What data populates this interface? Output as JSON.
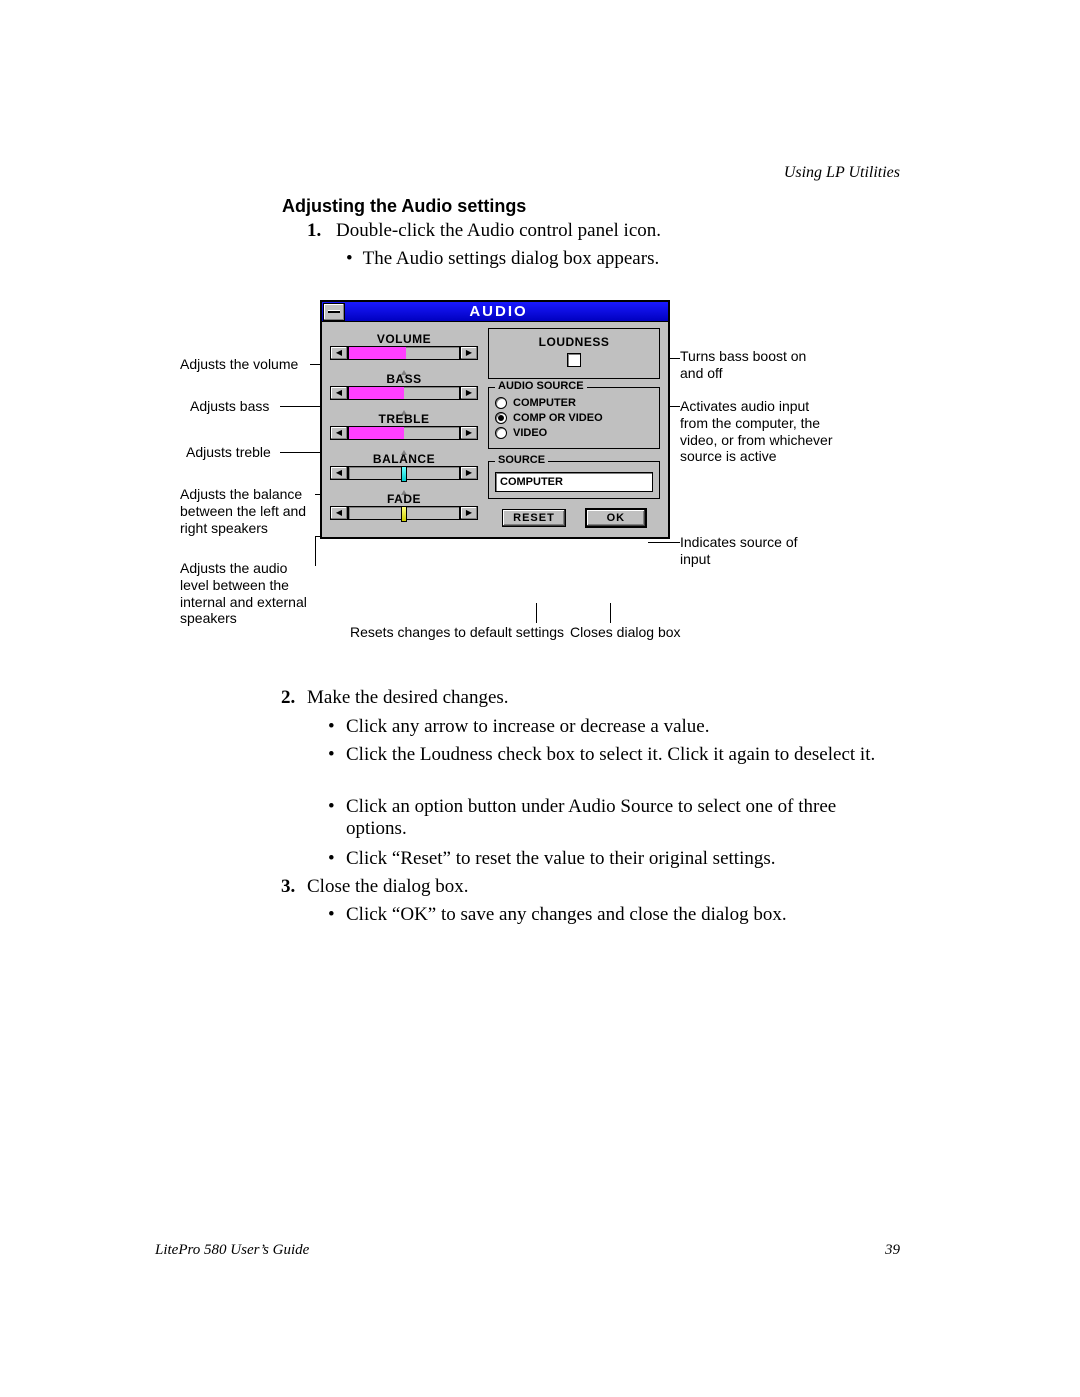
{
  "header": {
    "right": "Using LP Utilities"
  },
  "section_title": "Adjusting the Audio settings",
  "step1_num": "1.",
  "step1_text": "Double-click the Audio control panel icon.",
  "step1_sub": "The Audio settings dialog box appears.",
  "dialog": {
    "title": "AUDIO",
    "sliders": {
      "volume": {
        "label": "VOLUME",
        "fill_pct": 52
      },
      "bass": {
        "label": "BASS",
        "fill_pct": 50
      },
      "treble": {
        "label": "TREBLE",
        "fill_pct": 50
      },
      "balance": {
        "label": "BALANCE",
        "thumb_pct": 50
      },
      "fade": {
        "label": "FADE",
        "thumb_pct": 50
      }
    },
    "loudness": {
      "label": "LOUDNESS",
      "checked": false
    },
    "audio_source": {
      "legend": "AUDIO SOURCE",
      "options": [
        {
          "label": "COMPUTER",
          "checked": false
        },
        {
          "label": "COMP OR VIDEO",
          "checked": true
        },
        {
          "label": "VIDEO",
          "checked": false
        }
      ]
    },
    "source": {
      "legend": "SOURCE",
      "value": "COMPUTER"
    },
    "buttons": {
      "reset": "RESET",
      "ok": "OK"
    }
  },
  "ann": {
    "volume": "Adjusts the volume",
    "bass": "Adjusts bass",
    "treble": "Adjusts treble",
    "balance": "Adjusts the balance between the left and right speakers",
    "fade": "Adjusts the audio level between the internal and external speakers",
    "loudness": "Turns bass boost on and off",
    "source_grp": "Activates audio input from the computer, the video, or from whichever source is active",
    "src_ind": "Indicates source of input",
    "reset": "Resets changes to default settings",
    "ok": "Closes dialog box"
  },
  "step2_num": "2.",
  "step2_text": "Make the desired changes.",
  "step2_subs": [
    "Click any arrow to increase or decrease a value.",
    "Click the Loudness check box to select it. Click it again to deselect it.",
    "Click an option button under Audio Source to select one of three options.",
    "Click “Reset” to reset the value to their original settings."
  ],
  "step3_num": "3.",
  "step3_text": "Close the dialog box.",
  "step3_sub": "Click “OK” to save any changes and close the dialog box.",
  "footer": {
    "left": "LitePro 580 User’s Guide",
    "right": "39"
  }
}
